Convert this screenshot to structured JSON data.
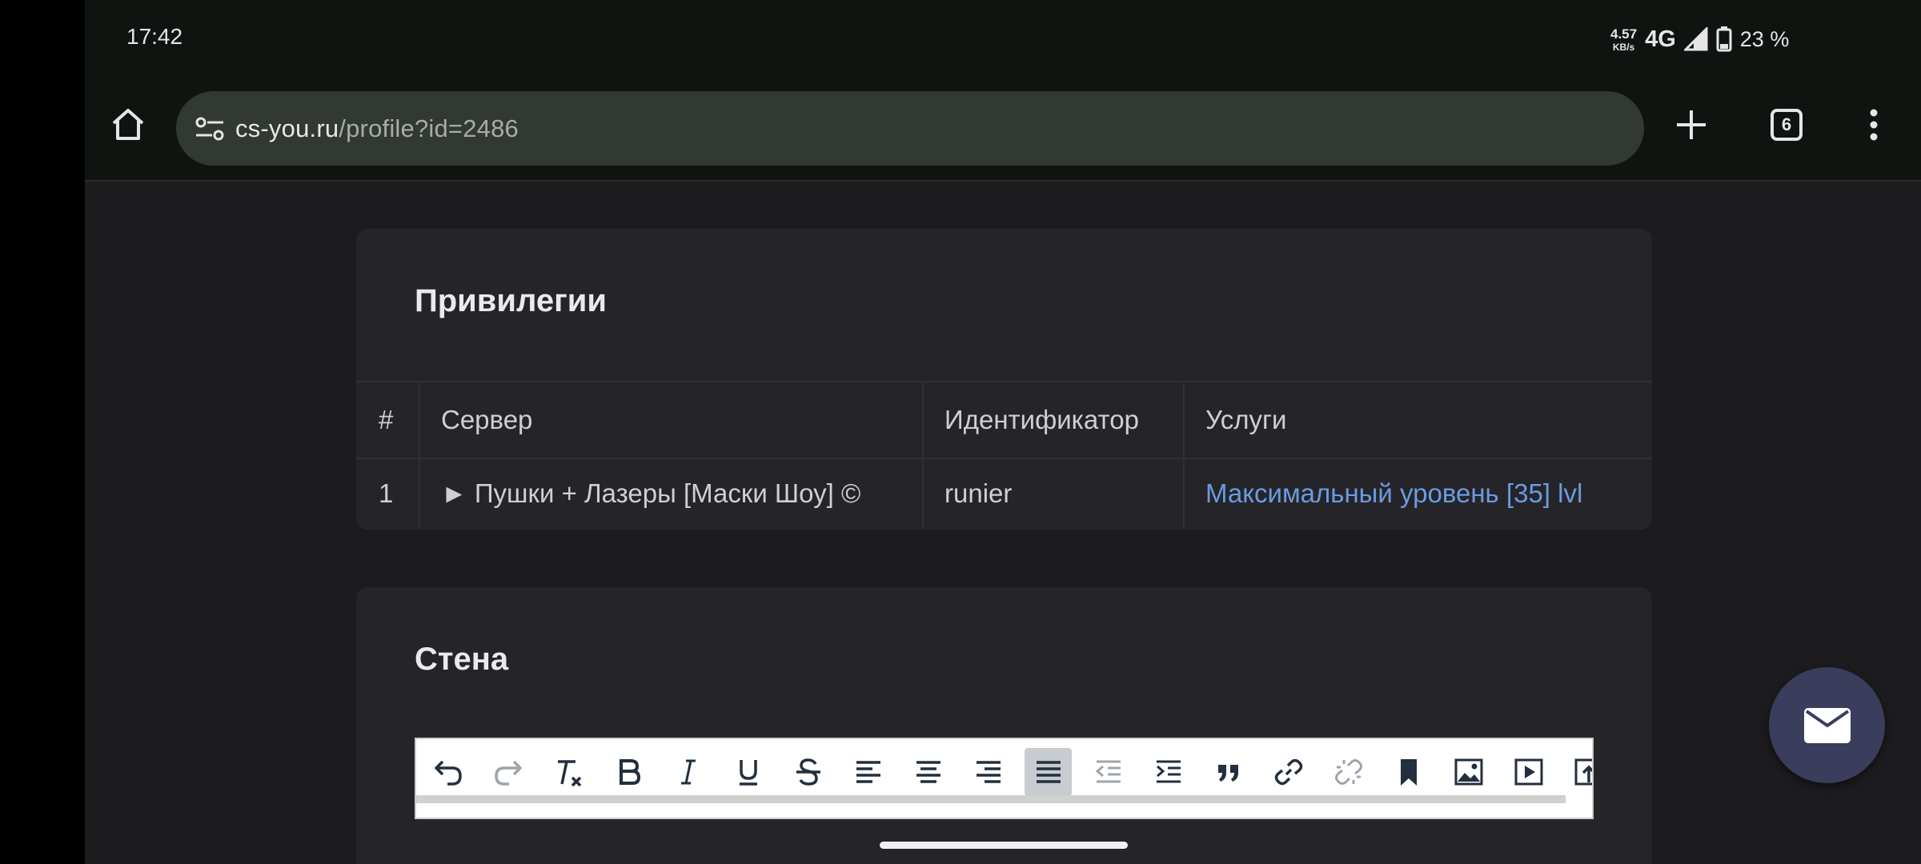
{
  "status_bar": {
    "time": "17:42",
    "net_speed": "4.57",
    "net_speed_unit": "KB/s",
    "network": "4G",
    "battery": "23 %"
  },
  "browser": {
    "url_domain": "cs-you.ru",
    "url_path": "/profile?id=2486",
    "tab_count": "6",
    "icons": [
      "home-icon",
      "site-settings-icon",
      "new-tab-plus-icon",
      "tabs-icon",
      "more-vert-icon"
    ]
  },
  "privileges": {
    "title": "Привилегии",
    "columns": [
      "#",
      "Сервер",
      "Идентификатор",
      "Услуги"
    ],
    "rows": [
      {
        "num": "1",
        "server": "► Пушки + Лазеры [Маски Шоу] ©",
        "identifier": "runier",
        "service": "Максимальный уровень [35] lvl"
      }
    ]
  },
  "wall": {
    "title": "Стена",
    "editor_tools": [
      "undo",
      "redo",
      "clear-formatting",
      "bold",
      "italic",
      "underline",
      "strikethrough",
      "align-left",
      "align-center",
      "align-right",
      "justify",
      "outdent",
      "indent",
      "blockquote",
      "link",
      "unlink",
      "bookmark",
      "image",
      "media",
      "upload"
    ]
  },
  "colors": {
    "page_bg": "#1c1c1f",
    "card_bg": "#252529",
    "link": "#6c9ae0",
    "fab": "#3a3d5c"
  }
}
